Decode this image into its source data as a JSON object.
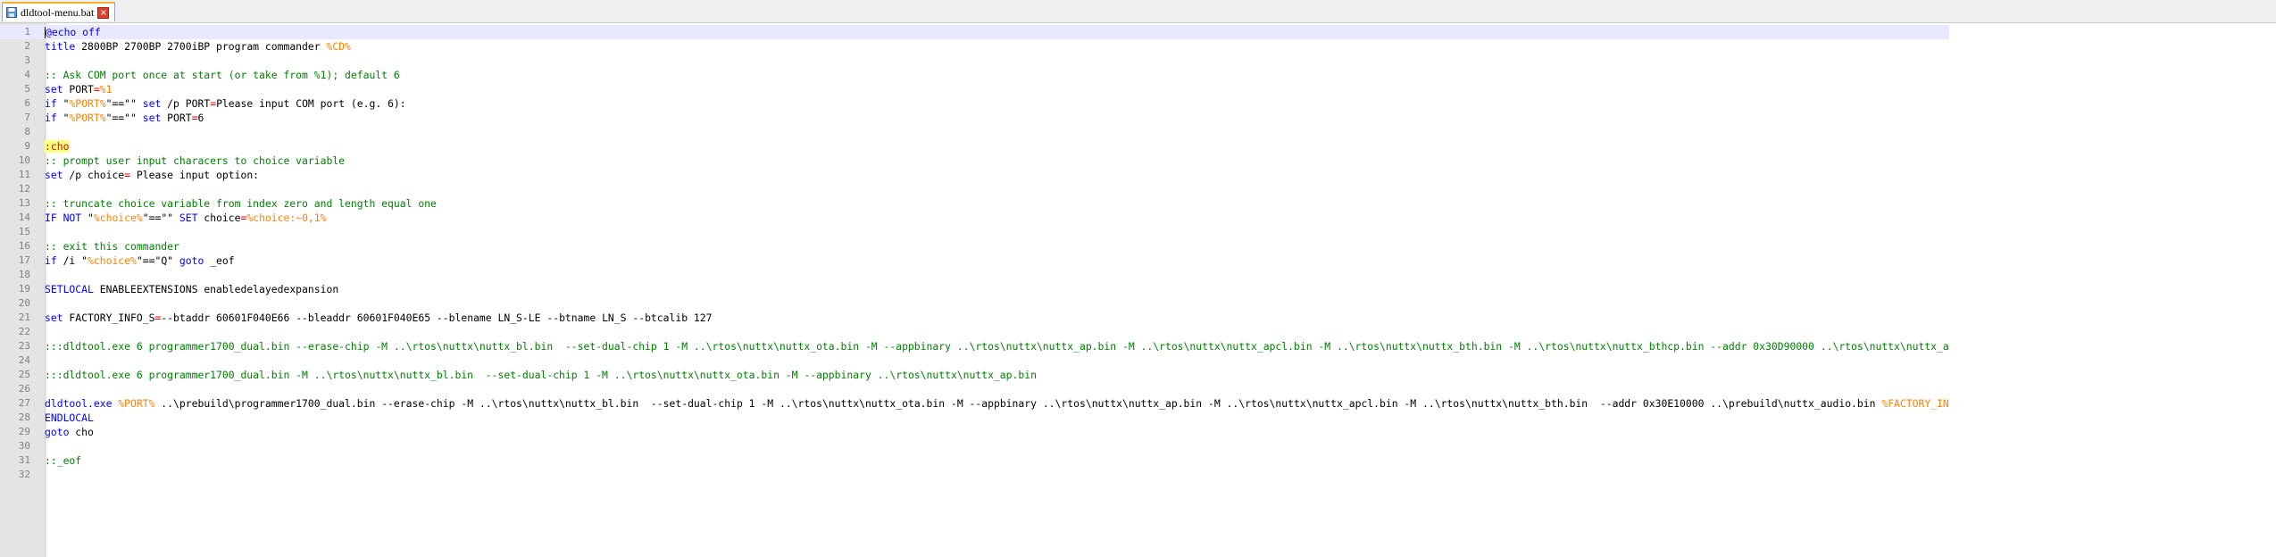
{
  "tab": {
    "title": "dldtool-menu.bat",
    "icon": "save-icon",
    "close_icon": "close-icon"
  },
  "editor": {
    "line_numbers": [
      "1",
      "2",
      "3",
      "4",
      "5",
      "6",
      "7",
      "8",
      "9",
      "10",
      "11",
      "12",
      "13",
      "14",
      "15",
      "16",
      "17",
      "18",
      "19",
      "20",
      "21",
      "22",
      "23",
      "24",
      "25",
      "26",
      "27",
      "28",
      "29",
      "30",
      "31",
      "32"
    ],
    "lines": [
      [
        {
          "t": "@echo off",
          "c": "kw-at"
        }
      ],
      [
        {
          "t": "title",
          "c": "kw"
        },
        {
          "t": " 2800BP 2700BP 2700iBP program commander ",
          "c": ""
        },
        {
          "t": "%CD%",
          "c": "var"
        }
      ],
      [],
      [
        {
          "t": ":: Ask COM port once at start (or take from %1); default 6",
          "c": "cmt"
        }
      ],
      [
        {
          "t": "set",
          "c": "kw"
        },
        {
          "t": " PORT",
          "c": ""
        },
        {
          "t": "=",
          "c": "op"
        },
        {
          "t": "%1",
          "c": "var"
        }
      ],
      [
        {
          "t": "if",
          "c": "kw"
        },
        {
          "t": " \"",
          "c": ""
        },
        {
          "t": "%PORT%",
          "c": "var"
        },
        {
          "t": "\"==\"\" ",
          "c": ""
        },
        {
          "t": "set",
          "c": "kw"
        },
        {
          "t": " /p PORT",
          "c": ""
        },
        {
          "t": "=",
          "c": "op"
        },
        {
          "t": "Please input COM port (e.g. 6):",
          "c": ""
        }
      ],
      [
        {
          "t": "if",
          "c": "kw"
        },
        {
          "t": " \"",
          "c": ""
        },
        {
          "t": "%PORT%",
          "c": "var"
        },
        {
          "t": "\"==\"\" ",
          "c": ""
        },
        {
          "t": "set",
          "c": "kw"
        },
        {
          "t": " PORT",
          "c": ""
        },
        {
          "t": "=",
          "c": "op"
        },
        {
          "t": "6",
          "c": ""
        }
      ],
      [],
      [
        {
          "t": ":cho",
          "c": "lbl"
        }
      ],
      [
        {
          "t": ":: prompt user input characers to choice variable",
          "c": "cmt"
        }
      ],
      [
        {
          "t": "set",
          "c": "kw"
        },
        {
          "t": " /p choice",
          "c": ""
        },
        {
          "t": "=",
          "c": "op"
        },
        {
          "t": " Please input option:",
          "c": ""
        }
      ],
      [],
      [
        {
          "t": ":: truncate choice variable from index zero and length equal one",
          "c": "cmt"
        }
      ],
      [
        {
          "t": "IF NOT",
          "c": "kw"
        },
        {
          "t": " \"",
          "c": ""
        },
        {
          "t": "%choice%",
          "c": "var"
        },
        {
          "t": "\"==\"\" ",
          "c": ""
        },
        {
          "t": "SET",
          "c": "kw"
        },
        {
          "t": " choice",
          "c": ""
        },
        {
          "t": "=",
          "c": "op"
        },
        {
          "t": "%choice:~0,1%",
          "c": "var"
        }
      ],
      [],
      [
        {
          "t": ":: exit this commander",
          "c": "cmt"
        }
      ],
      [
        {
          "t": "if",
          "c": "kw"
        },
        {
          "t": " /i \"",
          "c": ""
        },
        {
          "t": "%choice%",
          "c": "var"
        },
        {
          "t": "\"==\"Q\" ",
          "c": ""
        },
        {
          "t": "goto",
          "c": "kw"
        },
        {
          "t": " _eof",
          "c": ""
        }
      ],
      [],
      [
        {
          "t": "SETLOCAL",
          "c": "kw"
        },
        {
          "t": " ENABLEEXTENSIONS enabledelayedexpansion",
          "c": ""
        }
      ],
      [],
      [
        {
          "t": "set",
          "c": "kw"
        },
        {
          "t": " FACTORY_INFO_S",
          "c": ""
        },
        {
          "t": "=",
          "c": "op"
        },
        {
          "t": "--btaddr 60601F040E66 --bleaddr 60601F040E65 --blename LN_S-LE --btname LN_S --btcalib 127",
          "c": ""
        }
      ],
      [],
      [
        {
          "t": ":::dldtool.exe 6 programmer1700_dual.bin --erase-chip -M ..\\rtos\\nuttx\\nuttx_bl.bin  --set-dual-chip 1 -M ..\\rtos\\nuttx\\nuttx_ota.bin -M --appbinary ..\\rtos\\nuttx\\nuttx_ap.bin -M ..\\rtos\\nuttx\\nuttx_apcl.bin -M ..\\rtos\\nuttx\\nuttx_bth.bin -M ..\\rtos\\nuttx\\nuttx_bthcp.bin --addr 0x30D90000 ..\\rtos\\nuttx\\nuttx_a",
          "c": "cmt"
        }
      ],
      [],
      [
        {
          "t": ":::dldtool.exe 6 programmer1700_dual.bin -M ..\\rtos\\nuttx\\nuttx_bl.bin  --set-dual-chip 1 -M ..\\rtos\\nuttx\\nuttx_ota.bin -M --appbinary ..\\rtos\\nuttx\\nuttx_ap.bin",
          "c": "cmt"
        }
      ],
      [],
      [
        {
          "t": "dldtool.exe",
          "c": "cmd"
        },
        {
          "t": " ",
          "c": ""
        },
        {
          "t": "%PORT%",
          "c": "var"
        },
        {
          "t": " ..\\prebuild\\programmer1700_dual.bin --erase-chip -M ..\\rtos\\nuttx\\nuttx_bl.bin  --set-dual-chip 1 -M ..\\rtos\\nuttx\\nuttx_ota.bin -M --appbinary ..\\rtos\\nuttx\\nuttx_ap.bin -M ..\\rtos\\nuttx\\nuttx_apcl.bin -M ..\\rtos\\nuttx\\nuttx_bth.bin  --addr 0x30E10000 ..\\prebuild\\nuttx_audio.bin ",
          "c": ""
        },
        {
          "t": "%FACTORY_IN",
          "c": "var"
        }
      ],
      [
        {
          "t": "ENDLOCAL",
          "c": "kw"
        }
      ],
      [
        {
          "t": "goto",
          "c": "kw"
        },
        {
          "t": " cho",
          "c": ""
        }
      ],
      [],
      [
        {
          "t": "::_eof",
          "c": "cmt"
        }
      ],
      []
    ]
  }
}
